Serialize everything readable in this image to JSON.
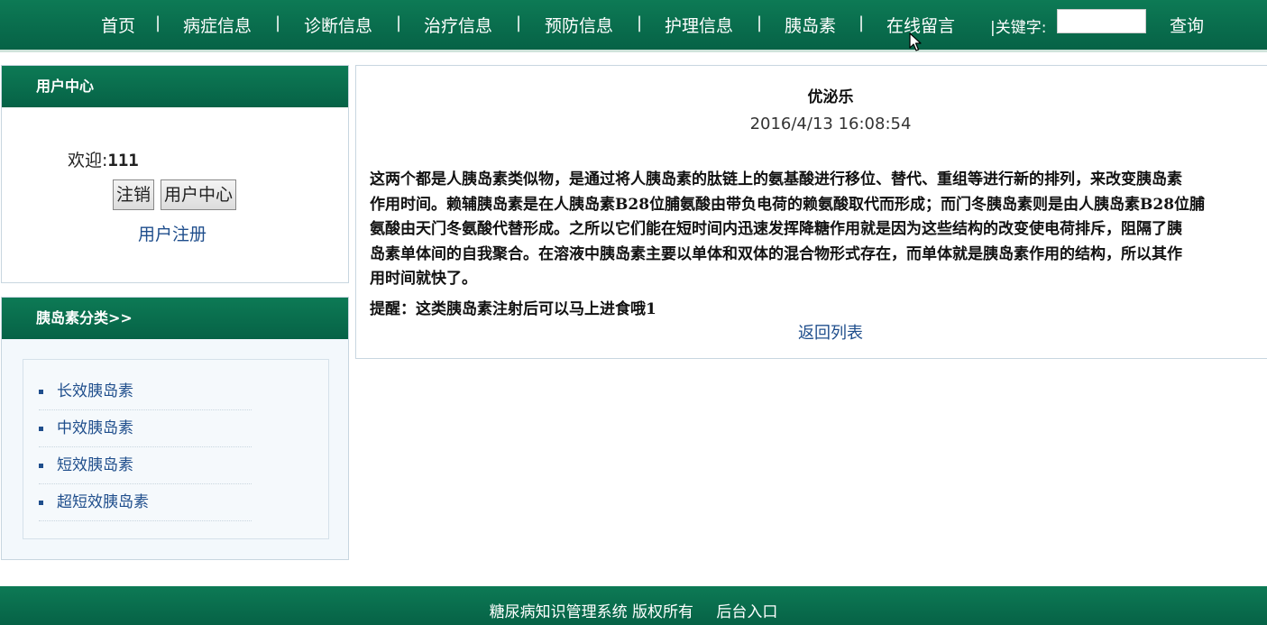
{
  "nav": {
    "items": [
      "首页",
      "病症信息",
      "诊断信息",
      "治疗信息",
      "预防信息",
      "护理信息",
      "胰岛素",
      "在线留言"
    ],
    "separator": "|",
    "keyword_label": "|关键字:",
    "keyword_value": "",
    "search_label": "查询"
  },
  "user_center": {
    "title": "用户中心",
    "welcome_label": "欢迎:",
    "username": "111",
    "logout_label": "注销",
    "center_label": "用户中心",
    "register_label": "用户注册"
  },
  "categories": {
    "title": "胰岛素分类>>",
    "items": [
      "长效胰岛素",
      "中效胰岛素",
      "短效胰岛素",
      "超短效胰岛素"
    ]
  },
  "article": {
    "title": "优泌乐",
    "date": "2016/4/13 16:08:54",
    "lines": [
      " 这两个都是人胰岛素类似物，是通过将人胰岛素的肽链上的氨基酸进行移位、替代、重组等进行新的排列，来改变胰岛素",
      "作用时间。赖辅胰岛素是在人胰岛素B28位脯氨酸由带负电荷的赖氨酸取代而形成；而门冬胰岛素则是由人胰岛素B28位脯",
      "氨酸由天门冬氨酸代替形成。之所以它们能在短时间内迅速发挥降糖作用就是因为这些结构的改变使电荷排斥，阻隔了胰",
      "岛素单体间的自我聚合。在溶液中胰岛素主要以单体和双体的混合物形式存在，而单体就是胰岛素作用的结构，所以其作",
      "用时间就快了。"
    ],
    "tip": "提醒：这类胰岛素注射后可以马上进食哦1",
    "back_label": "返回列表"
  },
  "footer": {
    "copyright": "糖尿病知识管理系统 版权所有",
    "admin_label": "后台入口"
  },
  "colors": {
    "brand_green": "#0d7a55",
    "link_blue": "#1f4e8c"
  }
}
